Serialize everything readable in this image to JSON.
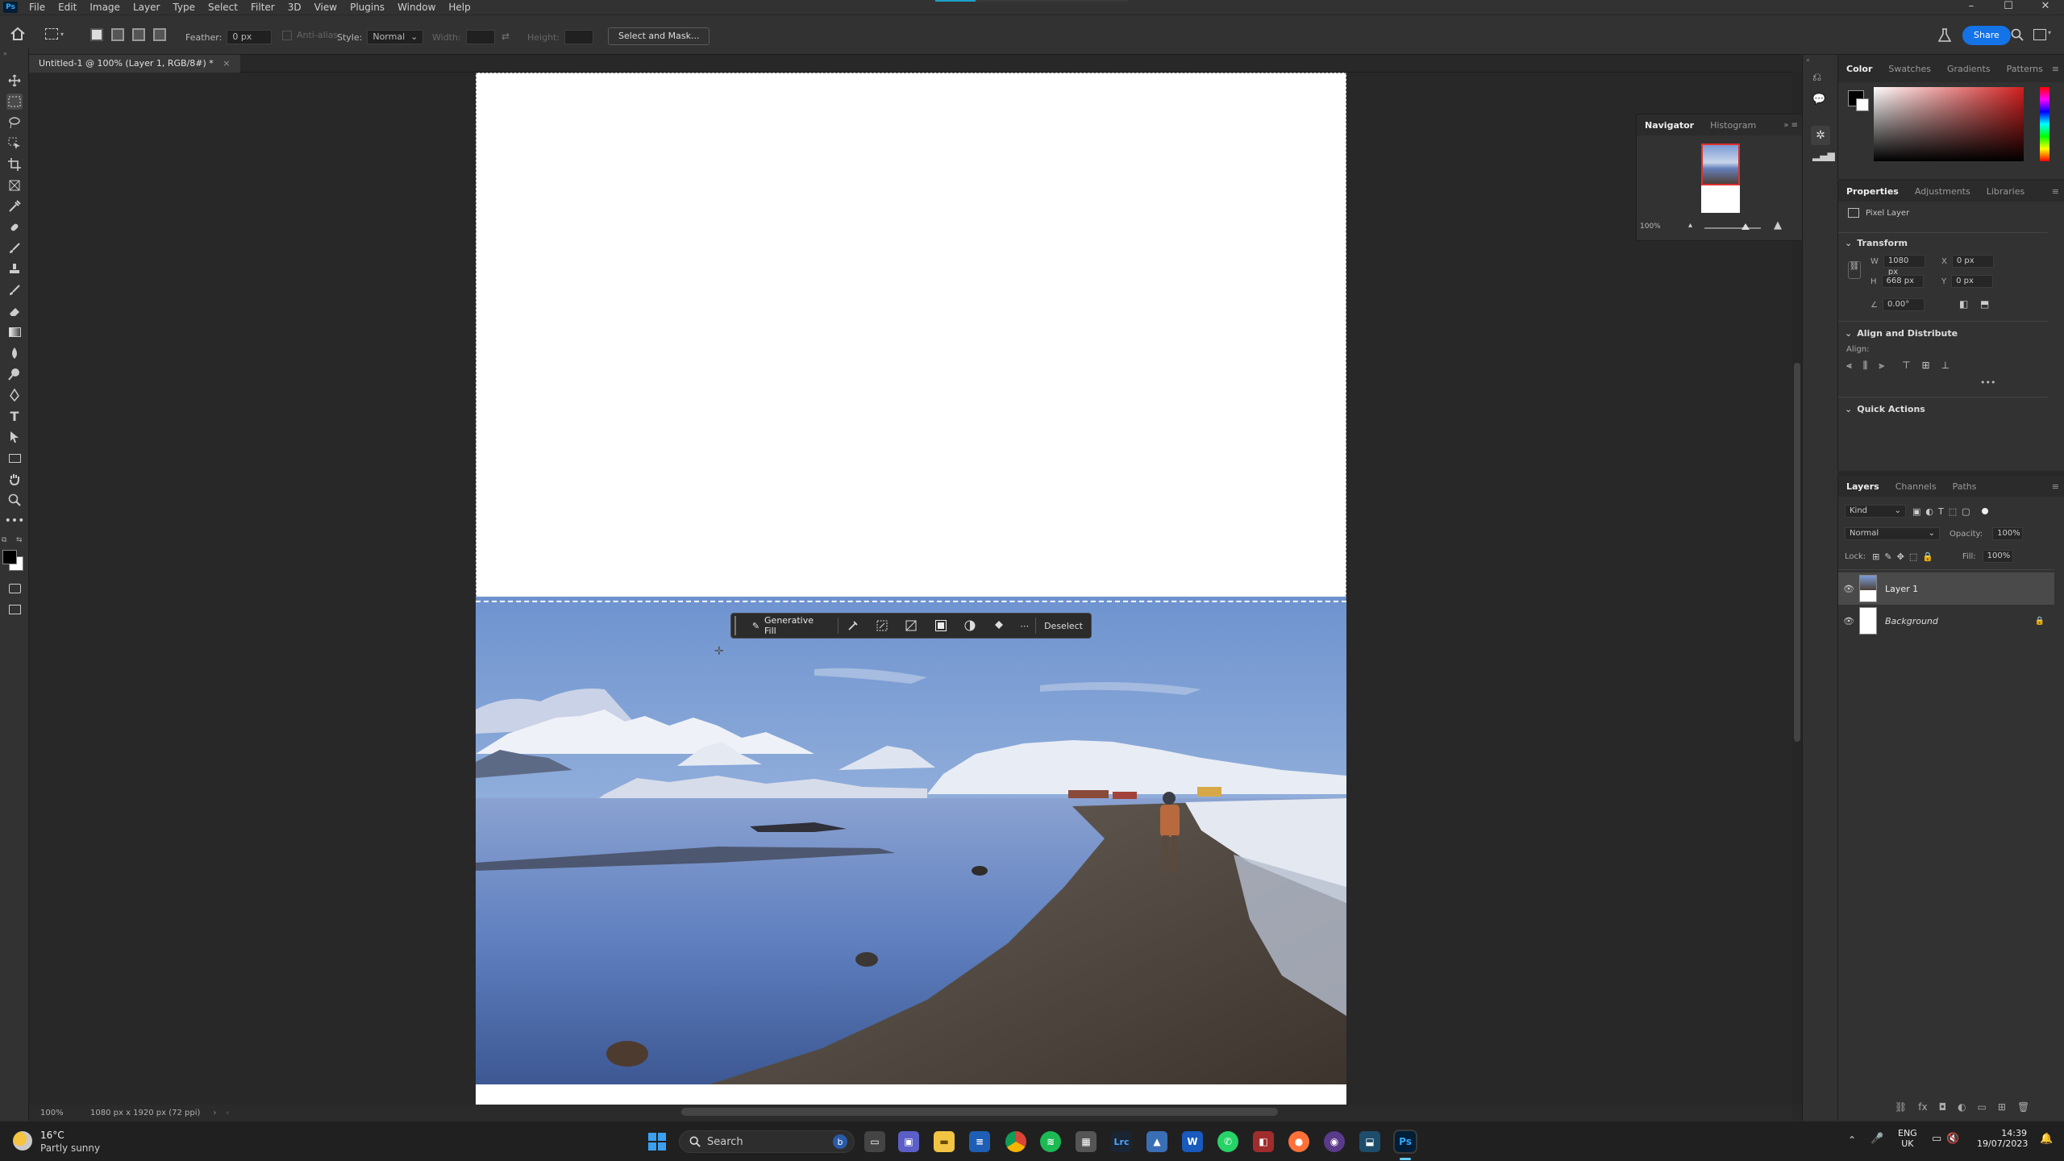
{
  "app": {
    "menu": [
      "File",
      "Edit",
      "Image",
      "Layer",
      "Type",
      "Select",
      "Filter",
      "3D",
      "View",
      "Plugins",
      "Window",
      "Help"
    ],
    "brand_color": "#31a8ff"
  },
  "options": {
    "feather_label": "Feather:",
    "feather_value": "0 px",
    "antialias_label": "Anti-alias",
    "style_label": "Style:",
    "style_value": "Normal",
    "width_label": "Width:",
    "height_label": "Height:",
    "select_mask": "Select and Mask...",
    "share": "Share"
  },
  "document": {
    "tab_title": "Untitled-1 @ 100% (Layer 1, RGB/8#) *",
    "zoom": "100%",
    "info": "1080 px x 1920 px (72 ppi)"
  },
  "context_bar": {
    "generative_fill": "Generative Fill",
    "deselect": "Deselect"
  },
  "navigator": {
    "tabs": [
      "Navigator",
      "Histogram"
    ],
    "zoom": "100%"
  },
  "color_panel": {
    "tabs": [
      "Color",
      "Swatches",
      "Gradients",
      "Patterns"
    ]
  },
  "properties": {
    "tabs": [
      "Properties",
      "Adjustments",
      "Libraries"
    ],
    "kind": "Pixel Layer",
    "transform_title": "Transform",
    "w_label": "W",
    "w": "1080 px",
    "h_label": "H",
    "h": "668 px",
    "x_label": "X",
    "x": "0 px",
    "y_label": "Y",
    "y": "0 px",
    "angle": "0.00°",
    "align_title": "Align and Distribute",
    "align_label": "Align:",
    "quick_actions": "Quick Actions"
  },
  "layers": {
    "tabs": [
      "Layers",
      "Channels",
      "Paths"
    ],
    "kind": "Kind",
    "blend": "Normal",
    "opacity_label": "Opacity:",
    "opacity": "100%",
    "lock_label": "Lock:",
    "fill_label": "Fill:",
    "fill": "100%",
    "items": [
      {
        "name": "Layer 1"
      },
      {
        "name": "Background"
      }
    ]
  },
  "taskbar": {
    "weather_temp": "16°C",
    "weather_desc": "Partly sunny",
    "search": "Search",
    "lang_top": "ENG",
    "lang_bottom": "UK",
    "time": "14:39",
    "date": "19/07/2023"
  }
}
